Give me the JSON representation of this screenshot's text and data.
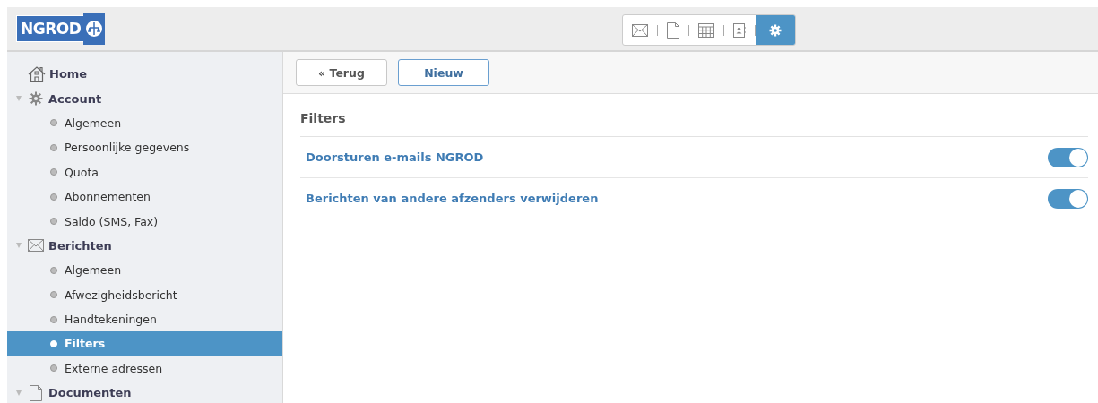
{
  "header": {
    "logo_text": "NGROD",
    "apps": [
      {
        "kind": "mail",
        "selected": false
      },
      {
        "kind": "document",
        "selected": false
      },
      {
        "kind": "calendar",
        "selected": false
      },
      {
        "kind": "contacts",
        "selected": false
      },
      {
        "kind": "settings",
        "selected": true
      }
    ]
  },
  "sidebar": {
    "items": [
      {
        "label": "Home",
        "kind": "home",
        "selected": false
      },
      {
        "label": "Account",
        "kind": "gear",
        "expanded": true,
        "selected": false,
        "children": [
          {
            "label": "Algemeen",
            "selected": false
          },
          {
            "label": "Persoonlijke gegevens",
            "selected": false
          },
          {
            "label": "Quota",
            "selected": false
          },
          {
            "label": "Abonnementen",
            "selected": false
          },
          {
            "label": "Saldo (SMS, Fax)",
            "selected": false
          }
        ]
      },
      {
        "label": "Berichten",
        "kind": "mail",
        "expanded": true,
        "selected": false,
        "children": [
          {
            "label": "Algemeen",
            "selected": false
          },
          {
            "label": "Afwezigheidsbericht",
            "selected": false
          },
          {
            "label": "Handtekeningen",
            "selected": false
          },
          {
            "label": "Filters",
            "selected": true
          },
          {
            "label": "Externe adressen",
            "selected": false
          }
        ]
      },
      {
        "label": "Documenten",
        "kind": "document",
        "expanded": true,
        "selected": false
      }
    ]
  },
  "toolbar": {
    "buttons": [
      {
        "label": "« Terug",
        "kind": "back"
      },
      {
        "label": "Nieuw",
        "kind": "primary"
      }
    ]
  },
  "section_title": "Filters",
  "filters": [
    {
      "label": "Doorsturen e-mails NGROD",
      "on": true
    },
    {
      "label": "Berichten van andere afzenders verwijderen",
      "on": true
    }
  ]
}
